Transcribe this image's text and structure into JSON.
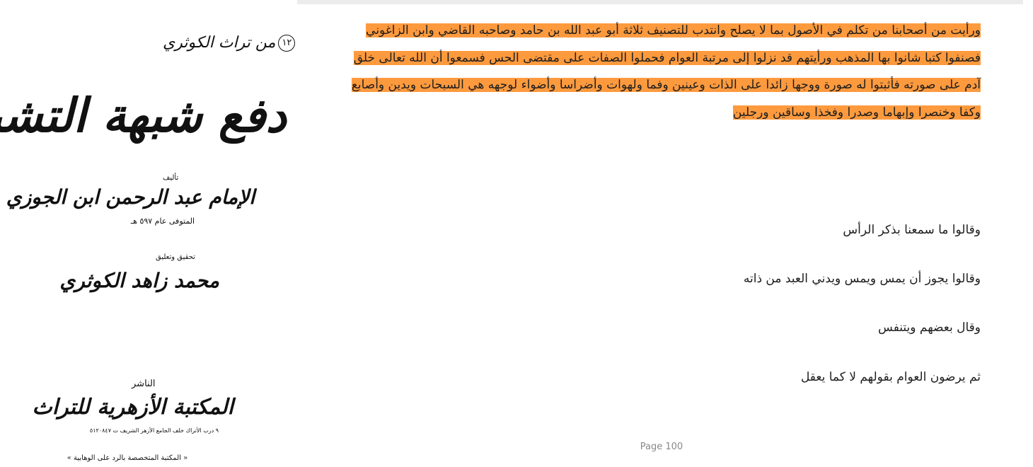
{
  "cover": {
    "series_number": "١٢",
    "series": "من تراث الكوثري",
    "title": "دفع شبهة التشبيه",
    "author_label": "تأليف",
    "author": "الإمام عبد الرحمن ابن الجوزي",
    "death_note": "المتوفى عام ٥٩٧ هـ",
    "editor_label": "تحقيق وتعليق",
    "editor": "محمد زاهد الكوثري",
    "publisher_label": "الناشر",
    "publisher": "المكتبة الأزهرية للتراث",
    "publisher_address": "٩ درب الأتراك خلف الجامع الأزهر الشريف ت ٥١٢٠٨٤٧",
    "publisher_note": "« المكتبة المتخصصة بالرد على الوهابية »"
  },
  "reader": {
    "highlighted_paragraph": "ورأيت من أصحابنا من تكلم في الأصول بما لا يصلح وانتدب للتصنيف ثلاثة أبو عبد الله بن حامد وصاحبه القاضي وابن الزاغوني فصنفوا كتبا شانوا بها المذهب ورأيتهم قد نزلوا إلى مرتبة العوام فحملوا الصفات على مقتضى الحس فسمعوا أن الله تعالى خلق آدم على صورته فأثبتوا له صورة ووجها زائدا على الذات وعينين وفما ولهوات وأضراسا وأضواء لوجهه هي السبحات ويدين وأصابع وكفا وخنصرا وإبهاما وصدرا وفخذا وساقين ورجلين",
    "lines": [
      "وقالوا ما سمعنا بذكر الرأس",
      "وقالوا يجوز أن يمس ويمس ويدني العبد من ذاته",
      "وقال بعضهم ويتنفس",
      "ثم يرضون العوام بقولهم لا كما يعقل"
    ],
    "page_label": "Page 100",
    "highlight_color": "#fd9a3e"
  }
}
